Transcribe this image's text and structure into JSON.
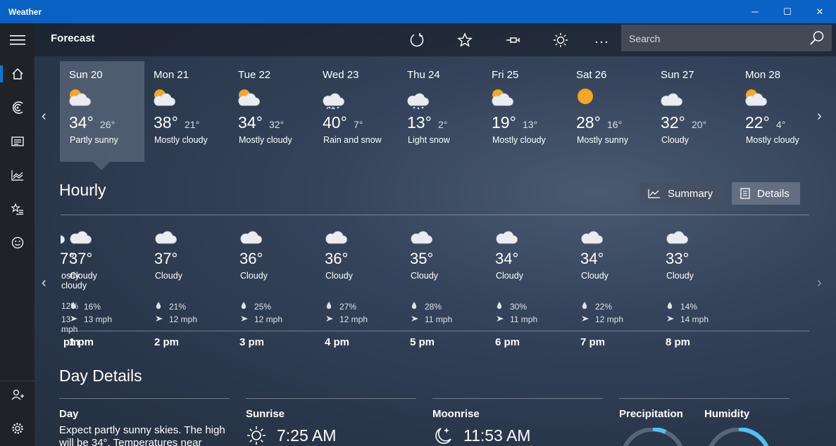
{
  "window": {
    "title": "Weather",
    "min": "─",
    "max": "☐",
    "close": "✕"
  },
  "header": {
    "title": "Forecast",
    "search_placeholder": "Search"
  },
  "days": [
    {
      "name": "Sun 20",
      "hi": "34°",
      "lo": "26°",
      "cond": "Partly sunny",
      "icon": "partly-sunny-icon"
    },
    {
      "name": "Mon 21",
      "hi": "38°",
      "lo": "21°",
      "cond": "Mostly cloudy",
      "icon": "mostly-cloudy-icon"
    },
    {
      "name": "Tue 22",
      "hi": "34°",
      "lo": "32°",
      "cond": "Mostly cloudy",
      "icon": "mostly-cloudy-icon"
    },
    {
      "name": "Wed 23",
      "hi": "40°",
      "lo": "7°",
      "cond": "Rain and snow",
      "icon": "rain-snow-icon"
    },
    {
      "name": "Thu 24",
      "hi": "13°",
      "lo": "2°",
      "cond": "Light snow",
      "icon": "light-snow-icon"
    },
    {
      "name": "Fri 25",
      "hi": "19°",
      "lo": "13°",
      "cond": "Mostly cloudy",
      "icon": "mostly-cloudy-icon"
    },
    {
      "name": "Sat 26",
      "hi": "28°",
      "lo": "16°",
      "cond": "Mostly sunny",
      "icon": "sunny-icon"
    },
    {
      "name": "Sun 27",
      "hi": "32°",
      "lo": "20°",
      "cond": "Cloudy",
      "icon": "cloudy-icon"
    },
    {
      "name": "Mon 28",
      "hi": "22°",
      "lo": "4°",
      "cond": "Mostly cloudy",
      "icon": "mostly-cloudy-icon"
    }
  ],
  "hourly": {
    "title": "Hourly",
    "summary_label": "Summary",
    "details_label": "Details",
    "hours": [
      {
        "temp": "7°",
        "cond": "ostly cloudy",
        "precip": "12%",
        "wind": "13 mph",
        "time": "pm"
      },
      {
        "temp": "37°",
        "cond": "Cloudy",
        "precip": "16%",
        "wind": "13 mph",
        "time": "1 pm"
      },
      {
        "temp": "37°",
        "cond": "Cloudy",
        "precip": "21%",
        "wind": "12 mph",
        "time": "2 pm"
      },
      {
        "temp": "36°",
        "cond": "Cloudy",
        "precip": "25%",
        "wind": "12 mph",
        "time": "3 pm"
      },
      {
        "temp": "36°",
        "cond": "Cloudy",
        "precip": "27%",
        "wind": "12 mph",
        "time": "4 pm"
      },
      {
        "temp": "35°",
        "cond": "Cloudy",
        "precip": "28%",
        "wind": "11 mph",
        "time": "5 pm"
      },
      {
        "temp": "34°",
        "cond": "Cloudy",
        "precip": "30%",
        "wind": "11 mph",
        "time": "6 pm"
      },
      {
        "temp": "34°",
        "cond": "Cloudy",
        "precip": "22%",
        "wind": "12 mph",
        "time": "7 pm"
      },
      {
        "temp": "33°",
        "cond": "Cloudy",
        "precip": "14%",
        "wind": "14 mph",
        "time": "8 pm"
      }
    ]
  },
  "day_details": {
    "title": "Day Details",
    "day_label": "Day",
    "day_text": "Expect partly sunny skies. The high will be 34°. Temperatures near",
    "sunrise_label": "Sunrise",
    "sunrise_value": "7:25 AM",
    "moonrise_label": "Moonrise",
    "moonrise_value": "11:53 AM",
    "precip_label": "Precipitation",
    "humidity_label": "Humidity"
  },
  "colors": {
    "titlebar": "#0a62c4",
    "accent": "#0a78d7",
    "gauge": "#4fc3f7",
    "sun": "#f5a623"
  }
}
